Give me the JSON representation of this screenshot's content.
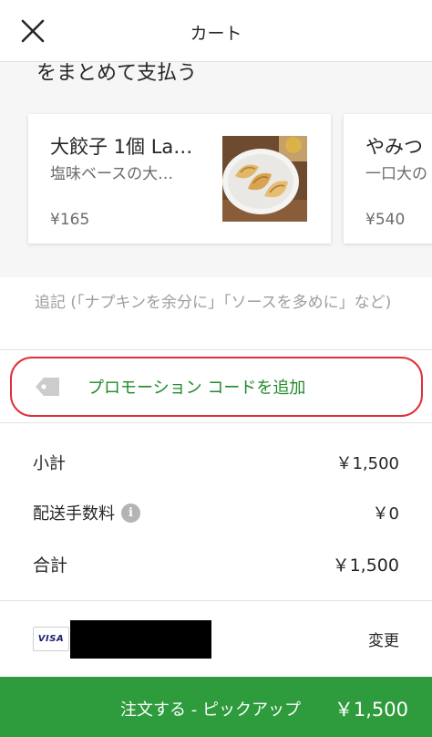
{
  "header": {
    "title": "カート",
    "close_icon": "close-icon"
  },
  "upsell": {
    "title": "をまとめて支払う",
    "items": [
      {
        "name": "大餃子 1個 La…",
        "description": "塩味ベースの大…",
        "price": "¥165",
        "image": "gyoza-plate"
      },
      {
        "name": "やみつ",
        "description": "一口大の",
        "price": "¥540"
      }
    ]
  },
  "note": {
    "placeholder": "追記 (「ナプキンを余分に」「ソースを多めに」など)"
  },
  "promo": {
    "label": "プロモーション コードを追加",
    "icon": "tag-icon",
    "ring_color": "#e02f3a"
  },
  "summary": {
    "subtotal_label": "小計",
    "subtotal_value": "￥1,500",
    "delivery_label": "配送手数料",
    "delivery_value": "￥0",
    "total_label": "合計",
    "total_value": "￥1,500",
    "info_icon": "i"
  },
  "payment": {
    "card_brand": "VISA",
    "change_label": "変更"
  },
  "order": {
    "label": "注文する - ピックアップ",
    "price": "￥1,500",
    "color": "#2e9b3d"
  },
  "colors": {
    "accent_green": "#1f8a2b",
    "highlight_red": "#e02f3a",
    "muted_text": "#6b6b6b"
  }
}
